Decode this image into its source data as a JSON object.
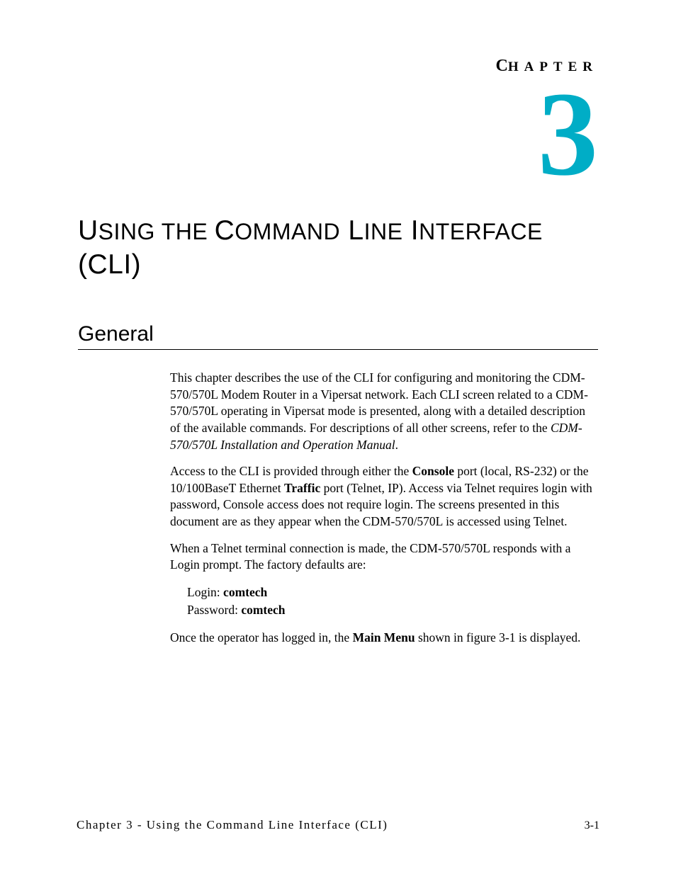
{
  "header": {
    "chapter_label_first": "C",
    "chapter_label_rest": "HAPTER",
    "chapter_number": "3"
  },
  "title": {
    "w1a": "U",
    "w1b": "SING",
    "w2a": " THE ",
    "w3a": "C",
    "w3b": "OMMAND",
    "w4a": " L",
    "w4b": "INE",
    "w5a": " I",
    "w5b": "NTERFACE",
    "line2": "(CLI)"
  },
  "section": {
    "heading": "General"
  },
  "paragraphs": {
    "p1_a": "This chapter describes the use of the CLI for configuring and monitoring the CDM-570/570L Modem Router in a Vipersat network. Each CLI screen related to a CDM-570/570L operating in Vipersat mode is presented, along with a detailed description of the available commands. For descriptions of all other screens, refer to the ",
    "p1_italic": "CDM-570/570L Installation and Operation Manual",
    "p1_b": ".",
    "p2_a": "Access to the CLI is provided through either the ",
    "p2_bold1": "Console",
    "p2_b": " port (local, RS-232) or the 10/100BaseT Ethernet ",
    "p2_bold2": "Traffic",
    "p2_c": " port (Telnet, IP). Access via Telnet requires login with password, Console access does not require login. The screens presented in this document are as they appear when the CDM-570/570L is accessed using Telnet.",
    "p3": "When a Telnet terminal connection is made, the CDM-570/570L responds with a Login prompt. The factory defaults are:",
    "login_label": "Login: ",
    "login_value": "comtech",
    "password_label": "Password: ",
    "password_value": "comtech",
    "p4_a": "Once the operator has logged in, the ",
    "p4_bold": "Main Menu",
    "p4_b": " shown in figure 3-1 is displayed."
  },
  "footer": {
    "left": "Chapter 3 - Using the Command Line Interface (CLI)",
    "right": "3-1"
  }
}
